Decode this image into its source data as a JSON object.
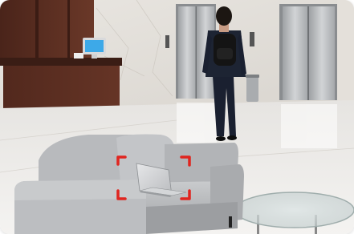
{
  "scene": {
    "subject": "laptop-on-sofa",
    "detection": {
      "target": "laptop",
      "bracket_color": "#e0251f"
    },
    "colors": {
      "marble": "#ece9e4",
      "wood": "#5a2e22",
      "elevator_steel": "#b7b9bb",
      "sofa": "#bfc1c3",
      "suit": "#1d2433",
      "monitor_screen": "#3da9e8"
    }
  }
}
